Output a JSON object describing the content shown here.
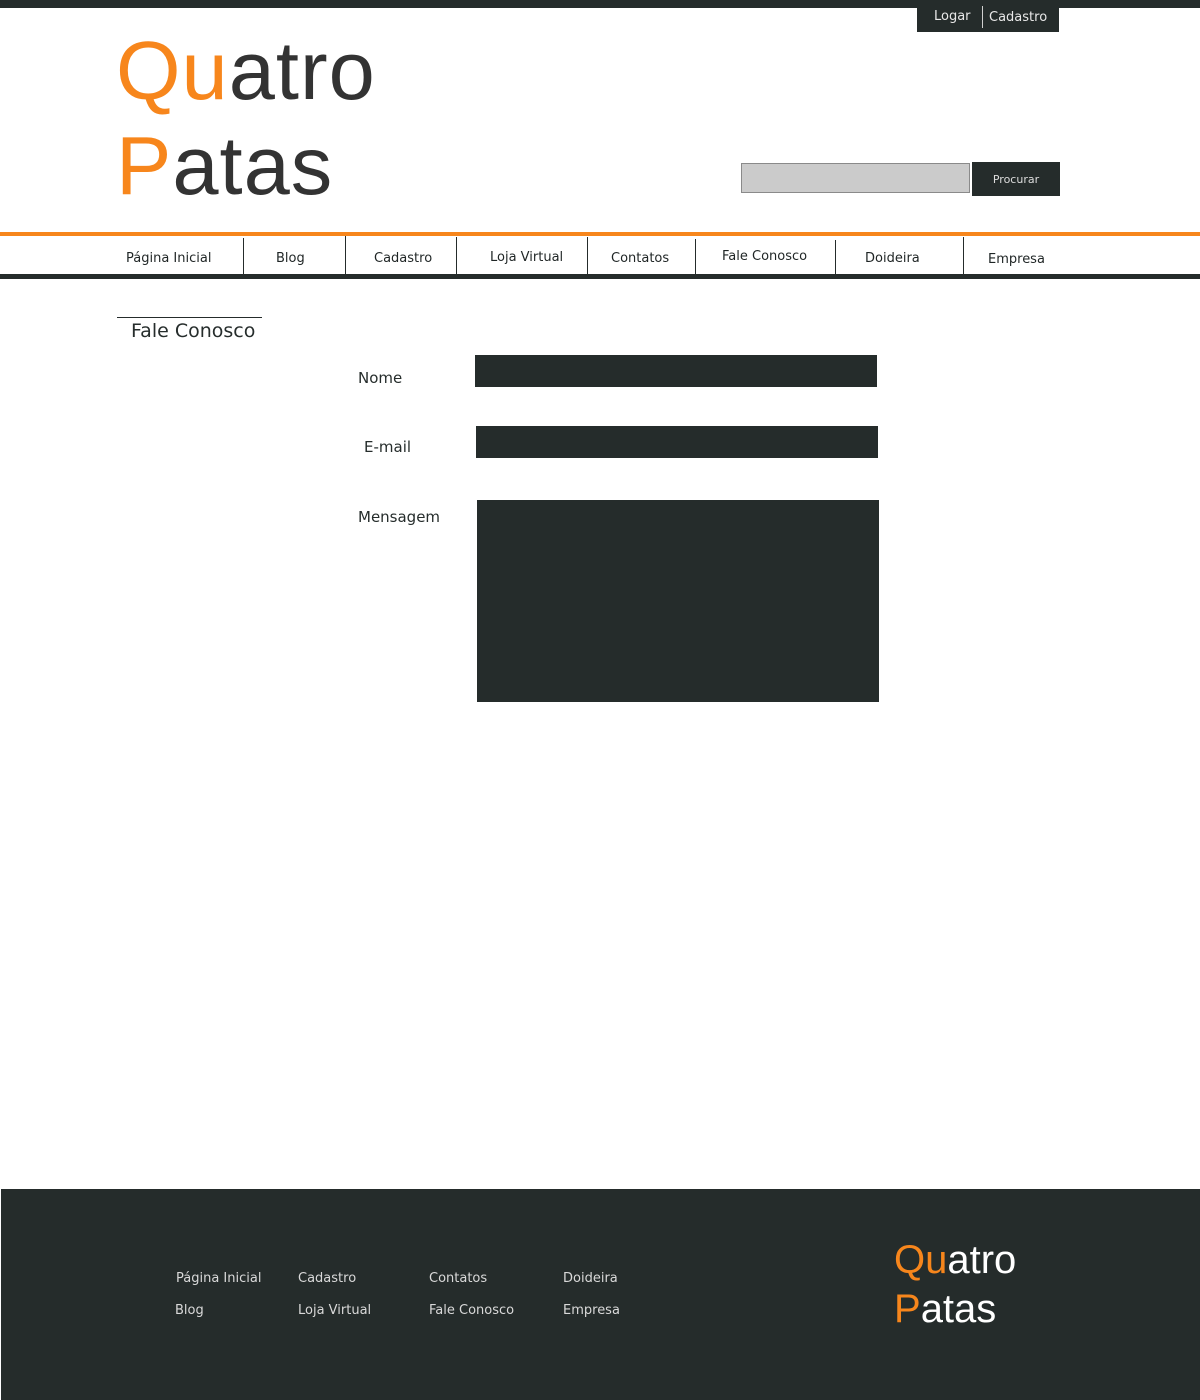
{
  "colors": {
    "accent": "#f7861c",
    "dark": "#252c2b",
    "search_bg": "#cbcbcb",
    "background": "#ffffff"
  },
  "auth": {
    "login_label": "Logar",
    "register_label": "Cadastro"
  },
  "logo": {
    "line1_accent": "Qu",
    "line1_rest": "atro",
    "line2_accent": "P",
    "line2_rest": "atas"
  },
  "search": {
    "value": "",
    "placeholder": "",
    "button_label": "Procurar"
  },
  "nav": {
    "items": [
      {
        "label": "Página Inicial"
      },
      {
        "label": "Blog"
      },
      {
        "label": "Cadastro"
      },
      {
        "label": "Loja Virtual"
      },
      {
        "label": "Contatos"
      },
      {
        "label": "Fale Conosco"
      },
      {
        "label": "Doideira"
      },
      {
        "label": "Empresa"
      }
    ]
  },
  "page": {
    "title": "Fale Conosco"
  },
  "form": {
    "name_label": "Nome",
    "name_value": "",
    "email_label": "E-mail",
    "email_value": "",
    "message_label": "Mensagem",
    "message_value": ""
  },
  "footer": {
    "links": [
      {
        "label": "Página Inicial"
      },
      {
        "label": "Blog"
      },
      {
        "label": "Cadastro"
      },
      {
        "label": "Loja Virtual"
      },
      {
        "label": "Contatos"
      },
      {
        "label": "Fale Conosco"
      },
      {
        "label": "Doideira"
      },
      {
        "label": "Empresa"
      }
    ],
    "logo": {
      "line1_accent": "Qu",
      "line1_rest": "atro",
      "line2_accent": "P",
      "line2_rest": "atas"
    }
  }
}
